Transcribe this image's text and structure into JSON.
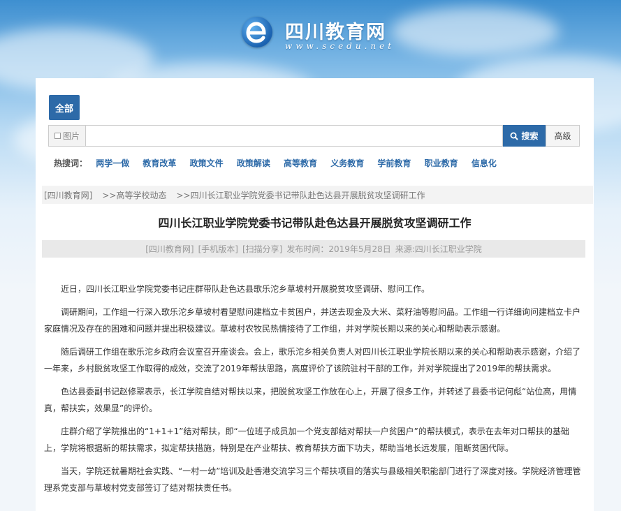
{
  "site": {
    "name": "四川教育网",
    "url": "www.scedu.net"
  },
  "search": {
    "category_tab": "全部",
    "scope_label": "图片",
    "input_value": "",
    "search_button": "搜索",
    "advanced_button": "高级"
  },
  "hot": {
    "label": "热搜词：",
    "items": [
      "两学一做",
      "教育改革",
      "政策文件",
      "政策解读",
      "高等教育",
      "义务教育",
      "学前教育",
      "职业教育",
      "信息化"
    ]
  },
  "breadcrumb": {
    "items": [
      "[四川教育网]",
      ">>高等学校动态",
      ">>四川长江职业学院党委书记带队赴色达县开展脱贫攻坚调研工作"
    ]
  },
  "article": {
    "title": "四川长江职业学院党委书记带队赴色达县开展脱贫攻坚调研工作",
    "meta": [
      "[四川教育网]",
      "[手机版本]",
      "[扫描分享]",
      "发布时间：2019年5月28日",
      "来源:四川长江职业学院"
    ],
    "paragraphs": [
      "近日，四川长江职业学院党委书记庄群带队赴色达县歌乐沱乡草坡村开展脱贫攻坚调研、慰问工作。",
      "调研期间，工作组一行深入歌乐沱乡草坡村看望慰问建档立卡贫困户，并送去现金及大米、菜籽油等慰问品。工作组一行详细询问建档立卡户家庭情况及存在的困难和问题并提出积极建议。草坡村农牧民热情接待了工作组，并对学院长期以来的关心和帮助表示感谢。",
      "随后调研工作组在歌乐沱乡政府会议室召开座谈会。会上，歌乐沱乡相关负责人对四川长江职业学院长期以来的关心和帮助表示感谢，介绍了一年来，乡村脱贫攻坚工作取得的成效，交流了2019年帮扶思路，高度评价了该院驻村干部的工作，并对学院提出了2019年的帮扶需求。",
      "色达县委副书记赵修翠表示，长江学院自结对帮扶以来，把脱贫攻坚工作放在心上，开展了很多工作，并转述了县委书记何彪“站位高，用情真，帮扶实，效果显”的评价。",
      "庄群介绍了学院推出的“1+1+1”结对帮扶，即“一位班子成员加一个党支部结对帮扶一户贫困户”的帮扶模式，表示在去年对口帮扶的基础上，学院将根据新的帮扶需求，拟定帮扶措施，特别是在产业帮扶、教育帮扶方面下功夫，帮助当地长远发展，阻断贫困代际。",
      "当天，学院还就暑期社会实践、“一村一幼”培训及赴香港交流学习三个帮扶项目的落实与县级相关职能部门进行了深度对接。学院经济管理管理系党支部与草坡村党支部签订了结对帮扶责任书。"
    ]
  },
  "colors": {
    "accent": "#2d6aa8",
    "sky_top": "#3e8fd0"
  },
  "icons": [
    "logo-e-icon",
    "search-icon",
    "checkbox-icon"
  ]
}
